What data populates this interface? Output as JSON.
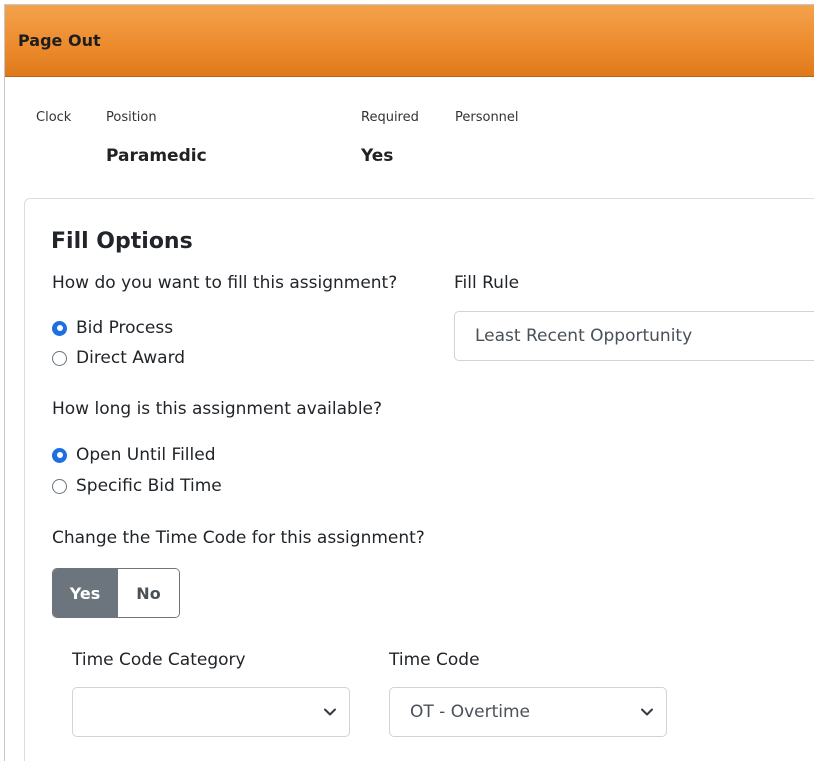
{
  "header": {
    "title": "Page Out"
  },
  "info": {
    "clock_label": "Clock",
    "position_label": "Position",
    "position_value": "Paramedic",
    "required_label": "Required",
    "required_value": "Yes",
    "personnel_label": "Personnel"
  },
  "fill_options": {
    "title": "Fill Options",
    "fill_question": "How do you want to fill this assignment?",
    "fill_methods": [
      {
        "label": "Bid Process",
        "selected": true
      },
      {
        "label": "Direct Award",
        "selected": false
      }
    ],
    "fill_rule_label": "Fill Rule",
    "fill_rule_value": "Least Recent Opportunity",
    "availability_question": "How long is this assignment available?",
    "availability_options": [
      {
        "label": "Open Until Filled",
        "selected": true
      },
      {
        "label": "Specific Bid Time",
        "selected": false
      }
    ],
    "time_code_question": "Change the Time Code for this assignment?",
    "toggle": {
      "yes_label": "Yes",
      "no_label": "No",
      "selected": "Yes"
    },
    "time_code_category_label": "Time Code Category",
    "time_code_category_value": "",
    "time_code_label": "Time Code",
    "time_code_value": "OT - Overtime"
  },
  "colors": {
    "header_orange": "#ec8a2c",
    "radio_checked": "#1e6fe0",
    "toggle_active": "#6c757d"
  },
  "icons": {
    "select_arrow": "chevron-down-icon"
  }
}
